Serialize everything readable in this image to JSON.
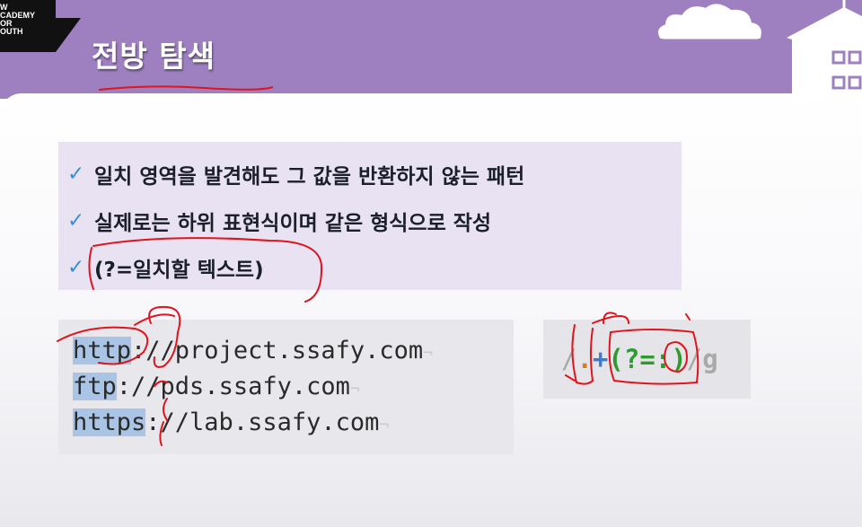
{
  "header": {
    "logo_text": "W\nCADEMY\nOR\nOUTH",
    "title": "전방 탐색"
  },
  "bullets": [
    {
      "check": "✓",
      "text": "일치 영역을 발견해도 그 값을 반환하지 않는 패턴"
    },
    {
      "check": "✓",
      "text": "실제로는 하위 표현식이며 같은 형식으로 작성"
    },
    {
      "check": "✓",
      "text": "(?=일치할 텍스트)"
    }
  ],
  "code_lines": [
    {
      "highlight": "http",
      "rest": "://project.ssafy.com",
      "pilcrow": "¬"
    },
    {
      "highlight": "ftp",
      "rest": "://pds.ssafy.com",
      "pilcrow": "¬"
    },
    {
      "highlight": "https",
      "rest": "://lab.ssafy.com",
      "pilcrow": "¬"
    }
  ],
  "regex": {
    "slash_open": "/",
    "dot": ".",
    "plus": "+",
    "group": "(?=:)",
    "slash_close": "/",
    "flag": "g"
  },
  "colors": {
    "header_bg": "#9e80c1",
    "bullet_box_bg": "#e8e2f3",
    "check_color": "#3a8fd6",
    "highlight": "#a9c4e4",
    "annotation_red": "#e0141c"
  },
  "icons": [
    "cloud-icon",
    "building-icon",
    "check-icon"
  ]
}
